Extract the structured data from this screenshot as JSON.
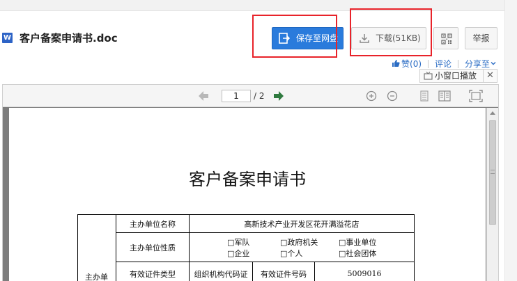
{
  "window": {
    "doc_title": "客户备案申请书.doc",
    "file_icon_letter": "W"
  },
  "actions": {
    "save_label": "保存至网盘",
    "download_label": "下载(51KB)",
    "report_label": "举报"
  },
  "social": {
    "like_label": "赞",
    "like_count": "(0)",
    "comment_label": "评论",
    "share_label": "分享至"
  },
  "mini_player": {
    "label": "小窗口播放",
    "close": "✕"
  },
  "viewer": {
    "page_current": "1",
    "page_total": "/ 2"
  },
  "document": {
    "title": "客户备案申请书",
    "table": {
      "side_label": "主办单",
      "row1_label": "主办单位名称",
      "row1_value": "高新技术产业开发区花开满溢花店",
      "row2_label": "主办单位性质",
      "options": [
        "□军队",
        "□政府机关",
        "□事业单位",
        "□企业",
        "□个人",
        "□社会团体"
      ],
      "row3_label": "有效证件类型",
      "row3_type": "组织机构代码证",
      "row3_number_label": "有效证件号码",
      "row3_number": "5009016"
    }
  },
  "colors": {
    "primary_button": "#2a7bdc",
    "highlight_box": "#e8232a",
    "link": "#2a6cc4"
  }
}
